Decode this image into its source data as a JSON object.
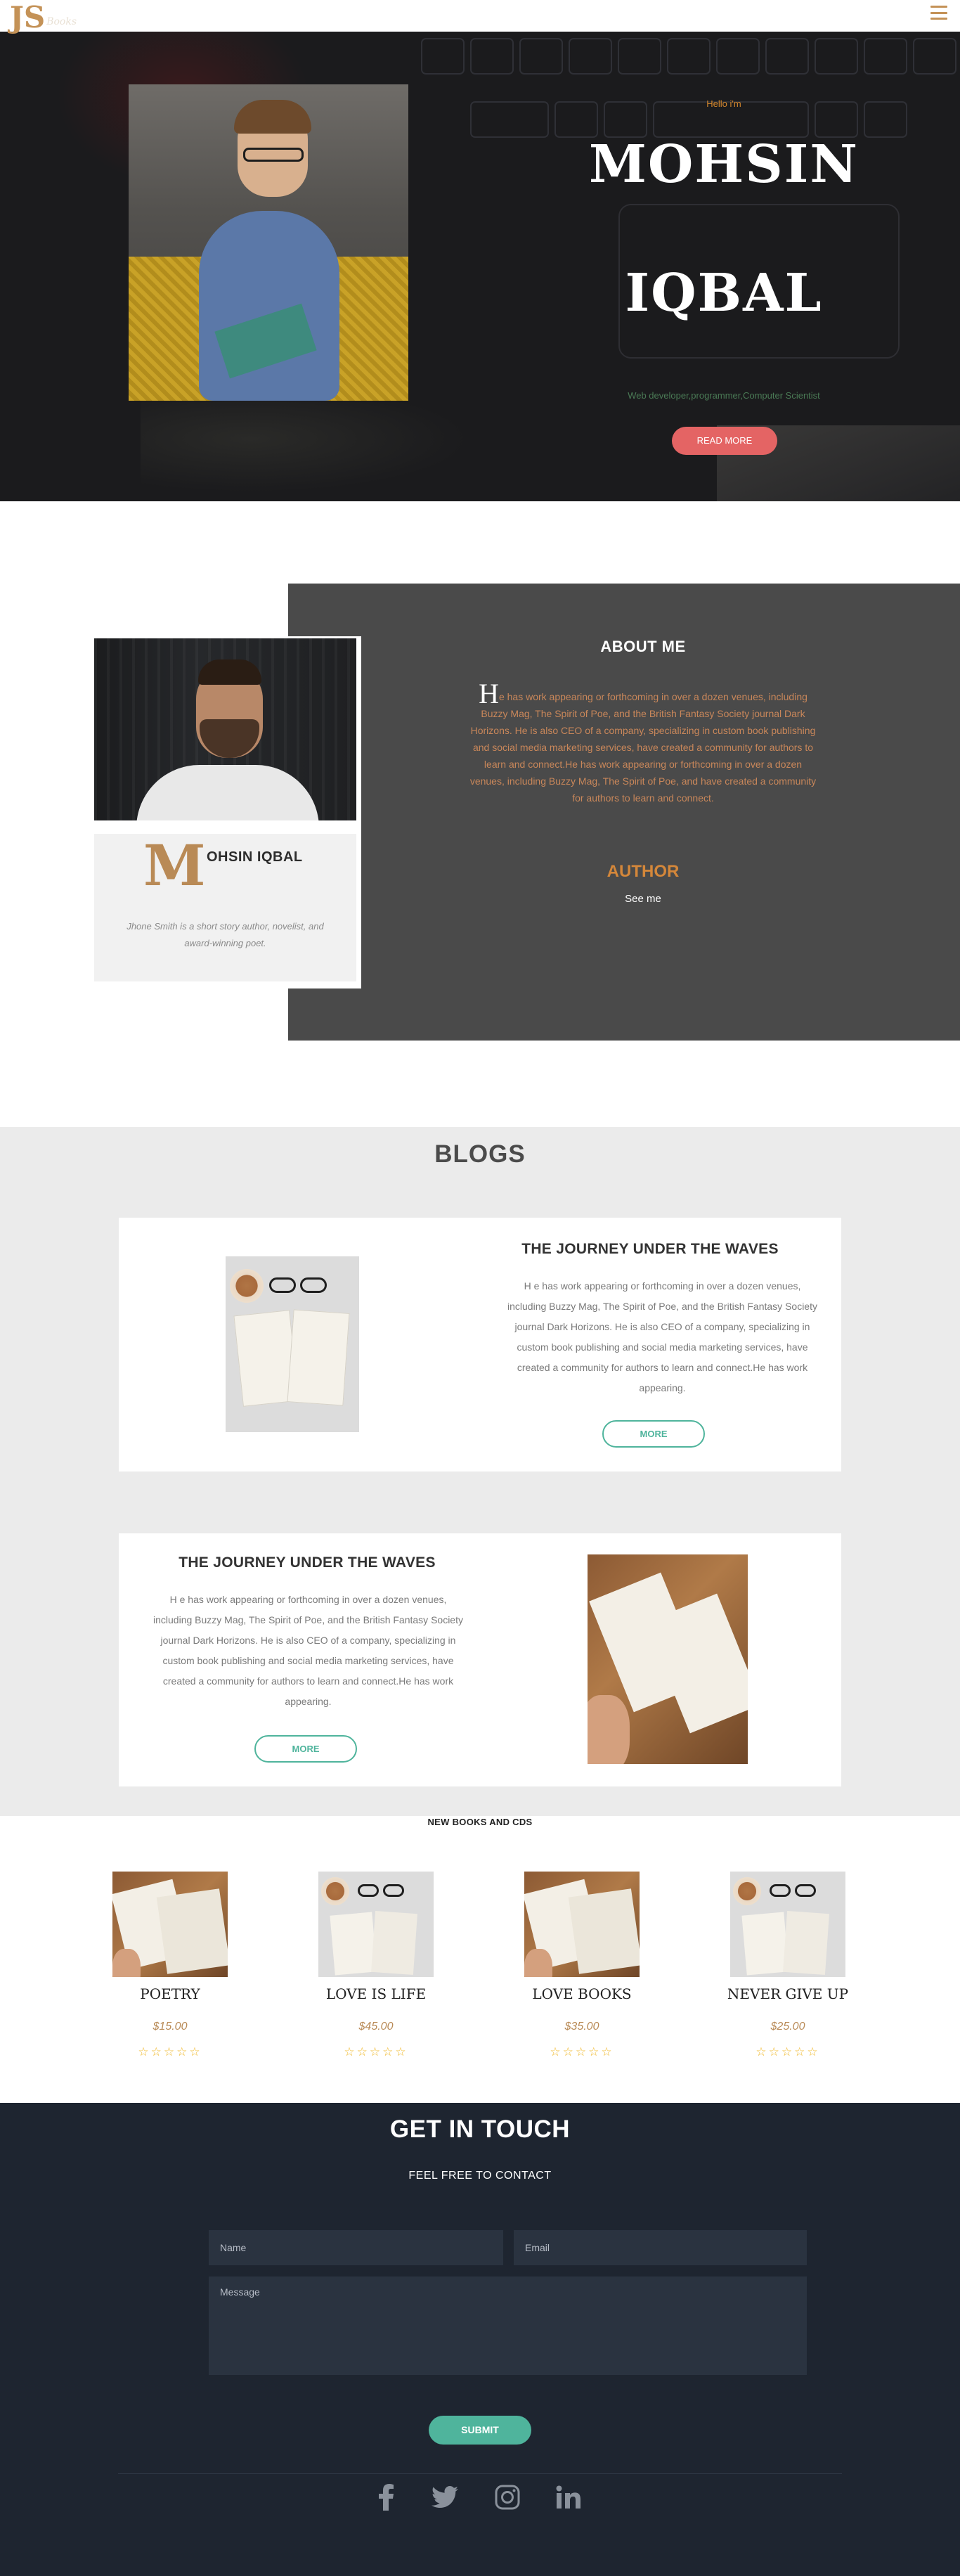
{
  "brand": {
    "logo_mark": "JS",
    "logo_word": "Books"
  },
  "nav": {
    "menu_icon": "hamburger-menu-icon"
  },
  "hero": {
    "greeting": "Hello i'm",
    "first_name": "MOHSIN",
    "last_name": "IQBAL",
    "subtitle": "Web developer,programmer,Computer Scientist",
    "button_label": "READ MORE"
  },
  "about": {
    "title": "ABOUT ME",
    "drop_letter": "H",
    "text": "e has work appearing or forthcoming in over a dozen venues, including Buzzy Mag, The Spirit of Poe, and the British Fantasy Society journal Dark Horizons. He is also CEO of a company, specializing in custom book publishing and social media marketing services, have created a community for authors to learn and connect.He has work appearing or forthcoming in over a dozen venues, including Buzzy Mag, The Spirit of Poe, and have created a community for authors to learn and connect.",
    "role": "AUTHOR",
    "see_me": "See me",
    "card": {
      "drop_letter": "M",
      "name": "OHSIN IQBAL",
      "bio": "Jhone Smith is a short story author, novelist, and award-winning poet."
    }
  },
  "blogs": {
    "title": "BLOGS",
    "posts": [
      {
        "heading": "THE JOURNEY UNDER THE WAVES",
        "text": "H e has work appearing or forthcoming in over a dozen venues, including Buzzy Mag, The Spirit of Poe, and the British Fantasy Society journal Dark Horizons. He is also CEO of a company, specializing in custom book publishing and social media marketing services, have created a community for authors to learn and connect.He has work appearing.",
        "button": "MORE"
      },
      {
        "heading": "THE JOURNEY UNDER THE WAVES",
        "text": "H e has work appearing or forthcoming in over a dozen venues, including Buzzy Mag, The Spirit of Poe, and the British Fantasy Society journal Dark Horizons. He is also CEO of a company, specializing in custom book publishing and social media marketing services, have created a community for authors to learn and connect.He has work appearing.",
        "button": "MORE"
      }
    ]
  },
  "books": {
    "title": "NEW BOOKS AND CDS",
    "items": [
      {
        "name": "POETRY",
        "price": "$15.00",
        "stars": "☆☆☆☆☆",
        "rating": 0
      },
      {
        "name": "LOVE IS LIFE",
        "price": "$45.00",
        "stars": "☆☆☆☆☆",
        "rating": 0
      },
      {
        "name": "LOVE BOOKS",
        "price": "$35.00",
        "stars": "☆☆☆☆☆",
        "rating": 0
      },
      {
        "name": "NEVER GIVE UP",
        "price": "$25.00",
        "stars": "☆☆☆☆☆",
        "rating": 0
      }
    ]
  },
  "contact": {
    "title": "GET IN TOUCH",
    "subtitle": "FEEL FREE TO CONTACT",
    "name_placeholder": "Name",
    "email_placeholder": "Email",
    "message_placeholder": "Message",
    "submit": "SUBMIT",
    "social": [
      "facebook-icon",
      "twitter-icon",
      "instagram-icon",
      "linkedin-icon"
    ]
  },
  "colors": {
    "accent_gold": "#c49257",
    "hero_button": "#e46464",
    "teal": "#4fb49c",
    "contact_bg": "#1e2530",
    "about_panel": "#4a4a4a"
  }
}
